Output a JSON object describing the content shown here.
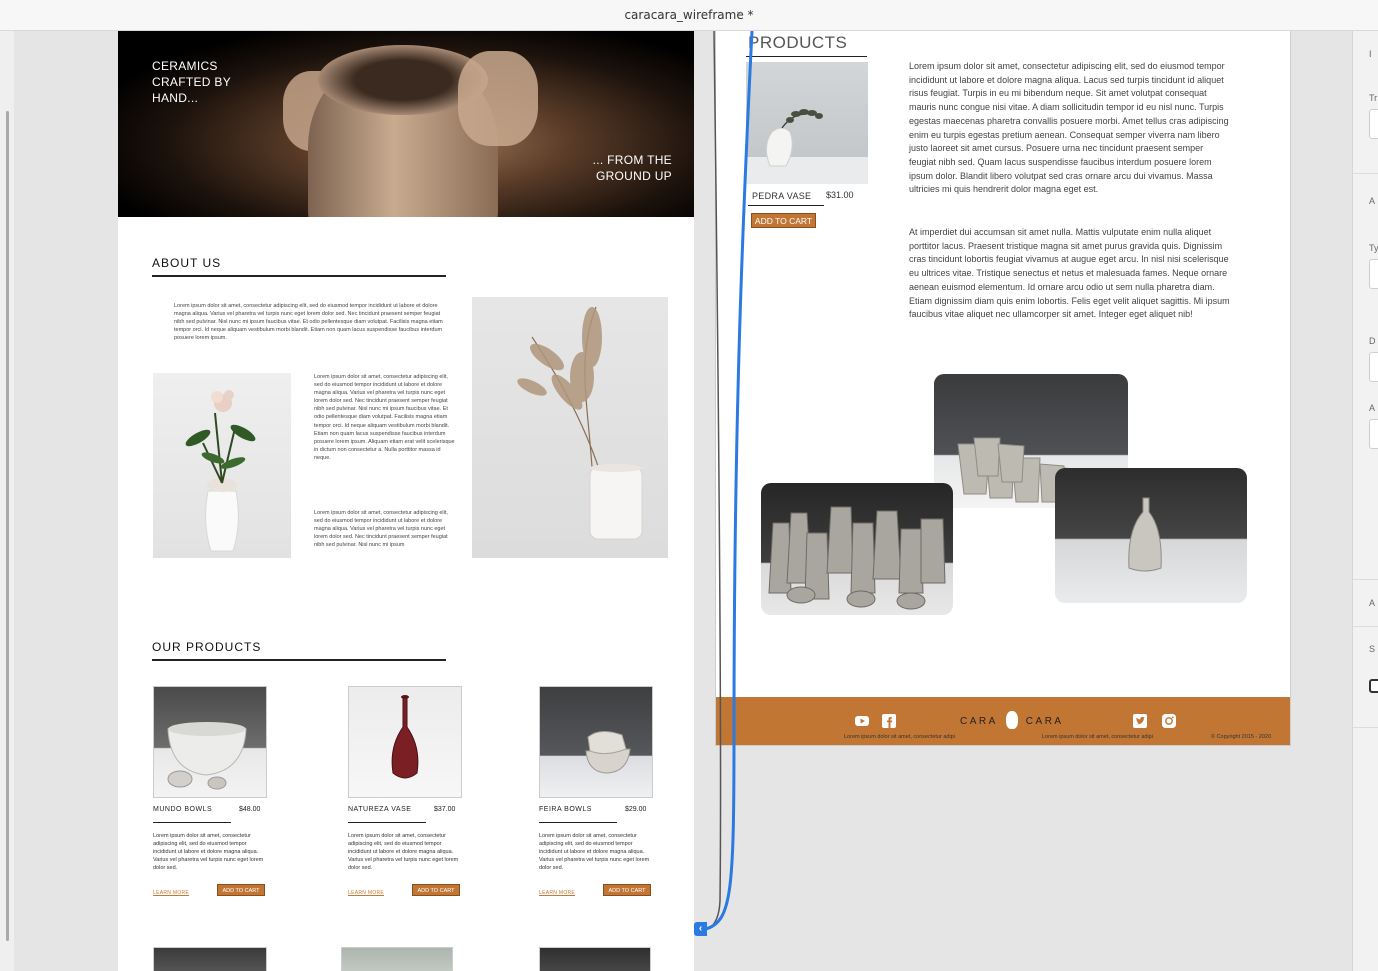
{
  "window": {
    "title": "caracara_wireframe",
    "modified_marker": "*"
  },
  "hero": {
    "line1": "CERAMICS CRAFTED BY HAND...",
    "line2": "... FROM THE GROUND UP"
  },
  "about": {
    "title": "ABOUT US",
    "para1": "Lorem ipsum dolor sit amet, consectetur adipiscing elit, sed do eiusmod tempor incididunt ut labore et dolore magna aliqua. Varius vel pharetra vel turpis nunc eget lorem dolor sed. Nec tincidunt praesent semper feugiat nibh sed pulvinar. Nisl nunc mi ipsum faucibus vitae. Et odio pellentesque diam volutpat. Facilisis magna etiam tempor orci. Id neque aliquam vestibulum morbi blandit. Etiam non quam lacus suspendisse faucibus interdum posuere lorem ipsum.",
    "para2": "Lorem ipsum dolor sit amet, consectetur adipiscing elit, sed do eiusmod tempor incididunt ut labore et dolore magna aliqua. Varius vel pharetra vel turpis nunc eget lorem dolor sed. Nec tincidunt praesent semper feugiat nibh sed pulvinar. Nisl nunc mi ipsum faucibus vitae. Et odio pellentesque diam volutpat. Facilisis magna etiam tempor orci. Id neque aliquam vestibulum morbi blandit. Etiam non quam lacus suspendisse faucibus interdum posuere lorem ipsum. Aliquam etiam erat velit scelerisque in dictum non consectetur a. Nulla porttitor massa id neque.",
    "para3": "Lorem ipsum dolor sit amet, consectetur adipiscing elit, sed do eiusmod tempor incididunt ut labore et dolore magna aliqua. Varius vel pharetra vel turpis nunc eget lorem dolor sed. Nec tincidunt praesent semper feugiat nibh sed pulvinar. Nisl nunc mi ipsum"
  },
  "products": {
    "title": "OUR PRODUCTS",
    "desc": "Lorem ipsum dolor sit amet, consectetur adipiscing elit, sed do eiusmod tempor incididunt ut labore et dolore magna aliqua. Varius vel pharetra vel turpis nunc eget lorem dolor sed.",
    "learn_more": "LEARN MORE",
    "add_to_cart": "ADD TO CART",
    "items": [
      {
        "name": "MUNDO BOWLS",
        "price": "$48.00"
      },
      {
        "name": "NATUREZA VASE",
        "price": "$37.00"
      },
      {
        "name": "FEIRA BOWLS",
        "price": "$29.00"
      }
    ]
  },
  "product_page": {
    "title": "PRODUCTS",
    "item_name": "PEDRA VASE",
    "item_price": "$31.00",
    "add_to_cart": "ADD TO CART",
    "para1": "Lorem ipsum dolor sit amet, consectetur adipiscing elit, sed do eiusmod tempor incididunt ut labore et dolore magna aliqua. Lacus sed turpis tincidunt id aliquet risus feugiat. Turpis in eu mi bibendum neque. Sit amet volutpat consequat mauris nunc congue nisi vitae. A diam sollicitudin tempor id eu nisl nunc. Turpis egestas maecenas pharetra convallis posuere morbi. Amet tellus cras adipiscing enim eu turpis egestas pretium aenean. Consequat semper viverra nam libero justo laoreet sit amet cursus. Posuere urna nec tincidunt praesent semper feugiat nibh sed. Quam lacus suspendisse faucibus interdum posuere lorem ipsum dolor. Blandit libero volutpat sed cras ornare arcu dui vivamus. Massa ultricies mi quis hendrerit dolor magna eget est.",
    "para2": "At imperdiet dui accumsan sit amet nulla. Mattis vulputate enim nulla aliquet porttitor lacus. Praesent tristique magna sit amet purus gravida quis. Dignissim cras tincidunt lobortis feugiat vivamus at augue eget arcu. In nisl nisi scelerisque eu ultrices vitae. Tristique senectus et netus et malesuada fames. Neque ornare aenean euismod elementum. Id ornare arcu odio ut sem nulla pharetra diam. Etiam dignissim diam quis enim lobortis. Felis eget velit aliquet sagittis. Mi ipsum faucibus vitae aliquet nec ullamcorper sit amet. Integer eget aliquet nib!"
  },
  "footer": {
    "logo_left": "CARA",
    "logo_right": "CARA",
    "tagline_left": "Lorem ipsum dolor sit amet, consectetur adipi",
    "tagline_right": "Lorem ipsum dolor sit amet, consectetur adipi",
    "copyright": "© Copyright 2015 - 2020"
  },
  "colors": {
    "accent": "#c27633",
    "connector": "#2a7ae2"
  }
}
